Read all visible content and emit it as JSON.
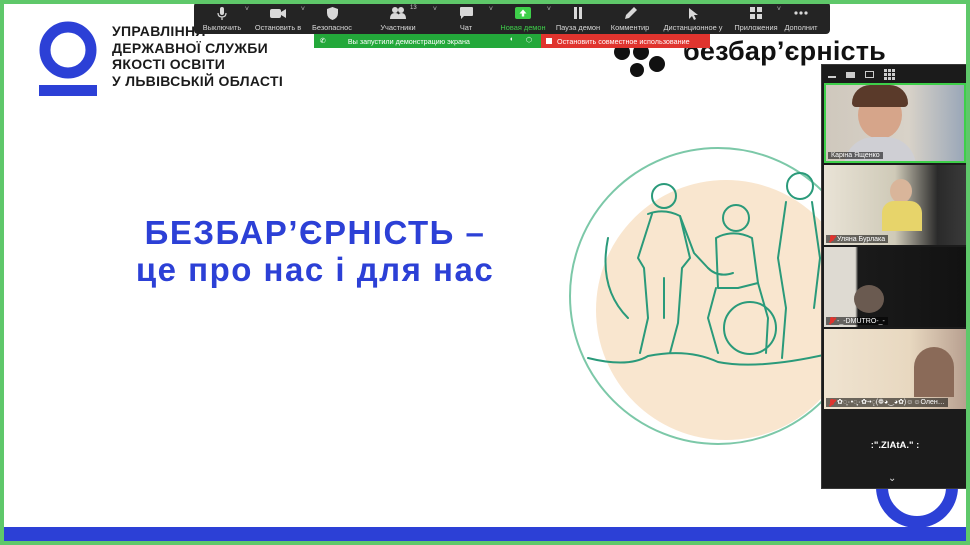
{
  "slide": {
    "org_lines": [
      "УПРАВЛІННЯ",
      "ДЕРЖАВНОЇ СЛУЖБИ",
      "ЯКОСТІ ОСВІТИ",
      "У ЛЬВІВСЬКІЙ ОБЛАСТІ"
    ],
    "brand_name": "безбар’єрність",
    "headline_line1": "БЕЗБАР’ЄРНІСТЬ –",
    "headline_line2": "це про нас і для нас",
    "colors": {
      "primary_blue": "#2c40d6",
      "illustration_circle": "#f9e6cf",
      "illustration_line": "#2a9a7a",
      "frame_green": "#5fc86a"
    }
  },
  "toolbar": {
    "items": [
      {
        "icon": "microphone-icon",
        "label": "Выключить",
        "caret": true
      },
      {
        "icon": "video-camera-icon",
        "label": "Остановить в",
        "caret": true
      },
      {
        "icon": "shield-icon",
        "label": "Безопаснос",
        "caret": false
      },
      {
        "icon": "participants-icon",
        "label": "Участники",
        "caret": true,
        "count": "13"
      },
      {
        "icon": "chat-icon",
        "label": "Чат",
        "caret": true
      },
      {
        "icon": "share-screen-icon",
        "label": "Новая демон",
        "caret": true,
        "active": true
      },
      {
        "icon": "pause-icon",
        "label": "Пауза демон",
        "caret": false
      },
      {
        "icon": "annotate-icon",
        "label": "Комментир",
        "caret": false
      },
      {
        "icon": "remote-control-icon",
        "label": "Дистанционное у",
        "caret": false
      },
      {
        "icon": "apps-icon",
        "label": "Приложения",
        "caret": true
      },
      {
        "icon": "more-icon",
        "label": "Дополнит",
        "caret": false
      }
    ]
  },
  "share_banner": {
    "status_text": "Вы запустили демонстрацию экрана",
    "stop_label": "Остановить совместное использование"
  },
  "video_panel": {
    "participants": [
      {
        "name": "Каріна Ященко",
        "muted": false
      },
      {
        "name": "Уляна Бурлака",
        "muted": true
      },
      {
        "name": "-_-DMUTRO-_-",
        "muted": true
      },
      {
        "name": "✿◌̥۰•◌̥̥۰✿ꞏ•◌̥(❁◕‿◕✿)☺☺Олен…",
        "muted": true
      }
    ],
    "name_only_tile": ":\".ZlAtA.\" :"
  }
}
